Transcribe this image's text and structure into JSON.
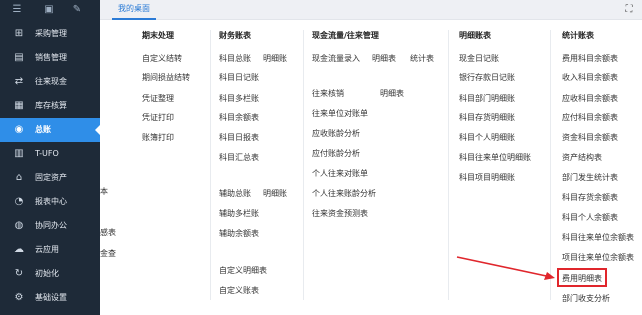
{
  "topbar": {
    "home_tab": "我的桌面",
    "icons": [
      "menu-icon",
      "window-icon",
      "edit-icon",
      "expand-icon"
    ]
  },
  "sidebar": {
    "items": [
      {
        "label": "采购管理",
        "icon": "cart-icon"
      },
      {
        "label": "销售管理",
        "icon": "sales-icon"
      },
      {
        "label": "往来现金",
        "icon": "cash-icon"
      },
      {
        "label": "库存核算",
        "icon": "inventory-icon"
      },
      {
        "label": "总账",
        "icon": "ledger-icon",
        "active": true
      },
      {
        "label": "T-UFO",
        "icon": "ufo-icon"
      },
      {
        "label": "固定资产",
        "icon": "asset-icon"
      },
      {
        "label": "报表中心",
        "icon": "report-icon"
      },
      {
        "label": "协同办公",
        "icon": "collab-icon"
      },
      {
        "label": "云应用",
        "icon": "cloud-icon"
      },
      {
        "label": "初始化",
        "icon": "init-icon"
      },
      {
        "label": "基础设置",
        "icon": "settings-icon"
      }
    ]
  },
  "obscured": {
    "fragments": [
      "本",
      "感表",
      "金查"
    ]
  },
  "menu": {
    "period_end": {
      "title": "期末处理",
      "links": [
        "自定义结转",
        "期间损益结转",
        "凭证整理",
        "凭证打印",
        "账簿打印"
      ]
    },
    "finance": {
      "title": "财务账表",
      "links": [
        "科目总账",
        "明细账",
        "科目日记账",
        "科目多栏账",
        "科目余额表",
        "科目日报表",
        "科目汇总表",
        "辅助总账",
        "明细账",
        "辅助多栏账",
        "辅助余额表",
        "自定义明细表",
        "自定义账表"
      ]
    },
    "cashflow": {
      "title": "现金流量/往来管理",
      "links": [
        "现金流量录入",
        "明细表",
        "统计表",
        "往来核销",
        "明细表",
        "往来单位对账单",
        "应收账龄分析",
        "应付账龄分析",
        "个人往来对账单",
        "个人往来账龄分析",
        "往来资金预测表"
      ]
    },
    "detail": {
      "title": "明细账表",
      "links": [
        "现金日记账",
        "银行存款日记账",
        "科目部门明细账",
        "科目存货明细账",
        "科目个人明细账",
        "科目往来单位明细账",
        "科目项目明细账"
      ]
    },
    "stats": {
      "title": "统计账表",
      "links": [
        "费用科目余额表",
        "收入科目余额表",
        "应收科目余额表",
        "应付科目余额表",
        "资金科目余额表",
        "资产结构表",
        "部门发生统计表",
        "科目存货余额表",
        "科目个人余额表",
        "科目往来单位余额表",
        "项目往来单位余额表",
        "费用明细表",
        "部门收支分析"
      ],
      "highlighted": "费用明细表"
    }
  },
  "colors": {
    "sidebar_bg": "#1e2a38",
    "active": "#2f8ee8",
    "highlight": "#e0262c",
    "tab_accent": "#2b7bd6"
  }
}
